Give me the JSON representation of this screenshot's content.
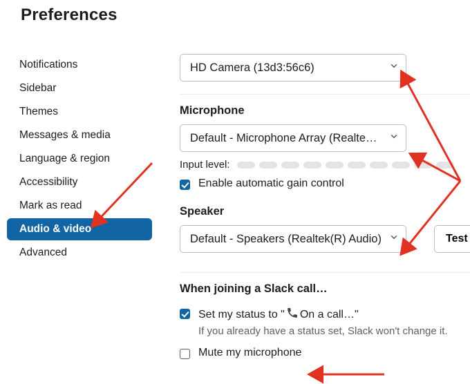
{
  "title": "Preferences",
  "sidebar": {
    "items": [
      {
        "label": "Notifications"
      },
      {
        "label": "Sidebar"
      },
      {
        "label": "Themes"
      },
      {
        "label": "Messages & media"
      },
      {
        "label": "Language & region"
      },
      {
        "label": "Accessibility"
      },
      {
        "label": "Mark as read"
      },
      {
        "label": "Audio & video"
      },
      {
        "label": "Advanced"
      }
    ],
    "selected_index": 7
  },
  "camera": {
    "selected": "HD Camera (13d3:56c6)"
  },
  "microphone": {
    "heading": "Microphone",
    "selected": "Default - Microphone Array (Realtek…",
    "input_level_label": "Input level:",
    "agc_label": "Enable automatic gain control",
    "agc_checked": true
  },
  "speaker": {
    "heading": "Speaker",
    "selected": "Default - Speakers (Realtek(R) Audio)",
    "test_label": "Test"
  },
  "join": {
    "heading": "When joining a Slack call…",
    "status_prefix": "Set my status to \"",
    "status_text": " On a call…\"",
    "status_checked": true,
    "status_hint": "If you already have a status set, Slack won't change it.",
    "mute_label": "Mute my microphone",
    "mute_checked": false
  },
  "colors": {
    "primary": "#1264a3",
    "arrow": "#e03121"
  }
}
